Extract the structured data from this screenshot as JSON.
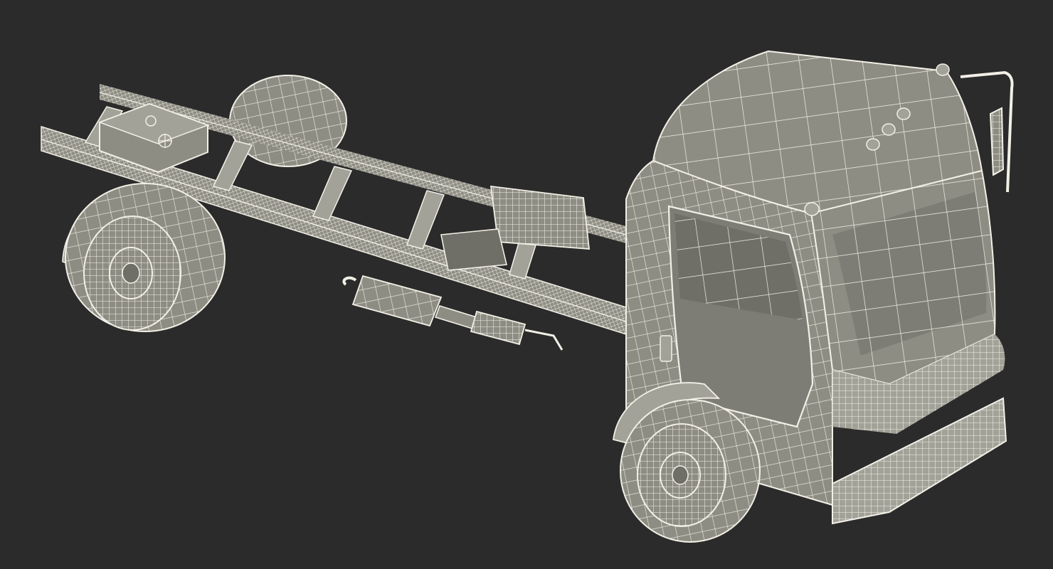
{
  "viewport": {
    "background": "#2b2b2b"
  },
  "render": {
    "style": "wireframe-over-shaded",
    "wire_color": "#f2f0e6",
    "shade_color": "#8e8d84",
    "shade_dark": "#6f6e67",
    "shade_light": "#a3a299"
  },
  "model": {
    "subject": "truck-chassis-cab",
    "parts": [
      "cab",
      "front-wheel",
      "rear-wheel-near",
      "rear-wheel-far",
      "frame-rails",
      "fuel-tank",
      "exhaust-muffler",
      "battery-box",
      "roof-marker-lights",
      "side-mirror"
    ]
  }
}
